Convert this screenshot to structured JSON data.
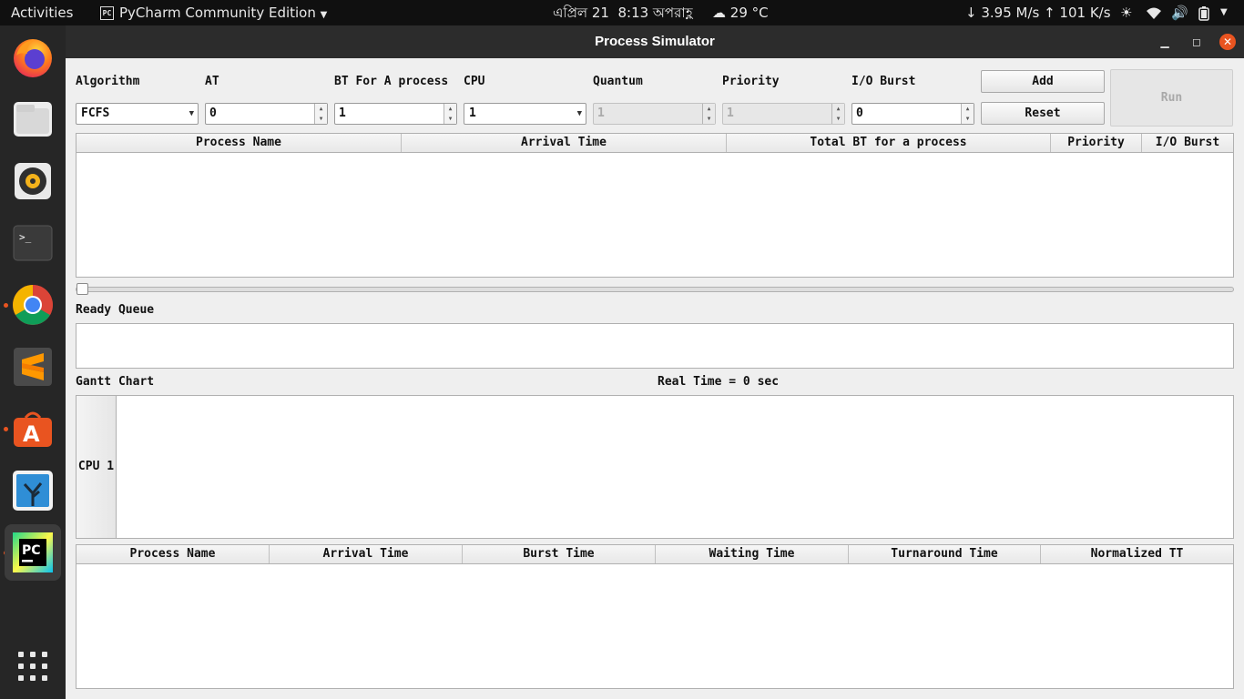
{
  "topbar": {
    "activities": "Activities",
    "app_name": "PyCharm Community Edition",
    "date": "এপ্রিল 21",
    "time": "8:13 অপরাহ্ণ",
    "weather": "29 °C",
    "net_speed": "↓ 3.95 M/s ↑ 101 K/s"
  },
  "dock": {
    "items": [
      "firefox-icon",
      "files-icon",
      "rhythmbox-icon",
      "terminal-icon",
      "chrome-icon",
      "sublime-text-icon",
      "ubuntu-software-icon",
      "shotwell-icon",
      "pycharm-icon",
      "show-apps-icon"
    ]
  },
  "window": {
    "title": "Process Simulator"
  },
  "form": {
    "algorithm_label": "Algorithm",
    "algorithm_value": "FCFS",
    "at_label": "AT",
    "at_value": "0",
    "bt_label": "BT For A process",
    "bt_value": "1",
    "cpu_label": "CPU",
    "cpu_value": "1",
    "quantum_label": "Quantum",
    "quantum_value": "1",
    "priority_label": "Priority",
    "priority_value": "1",
    "io_label": "I/O Burst",
    "io_value": "0",
    "add_label": "Add",
    "reset_label": "Reset",
    "run_label": "Run"
  },
  "process_table": {
    "columns": [
      "Process Name",
      "Arrival Time",
      "Total BT for a process",
      "Priority",
      "I/O Burst"
    ]
  },
  "ready_queue_label": "Ready Queue",
  "gantt": {
    "label": "Gantt Chart",
    "real_time": "Real Time = 0 sec",
    "cpu_row": "CPU 1"
  },
  "result_table": {
    "columns": [
      "Process Name",
      "Arrival Time",
      "Burst Time",
      "Waiting Time",
      "Turnaround Time",
      "Normalized TT"
    ]
  }
}
